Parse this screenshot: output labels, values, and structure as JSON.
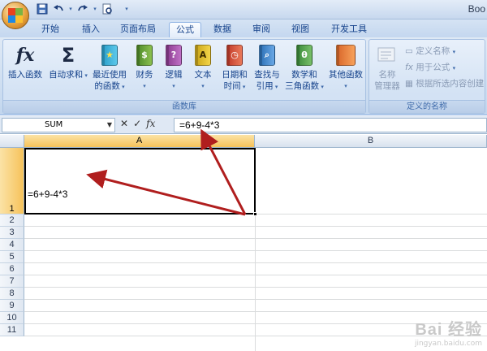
{
  "app": {
    "title": "Boo"
  },
  "quick_access": {
    "icons": [
      "save-icon",
      "undo-icon",
      "redo-icon",
      "print-preview-icon",
      "customize-dropdown-icon"
    ]
  },
  "tabs": [
    {
      "label": "开始"
    },
    {
      "label": "插入"
    },
    {
      "label": "页面布局"
    },
    {
      "label": "公式",
      "active": true
    },
    {
      "label": "数据"
    },
    {
      "label": "审阅"
    },
    {
      "label": "视图"
    },
    {
      "label": "开发工具"
    }
  ],
  "ribbon": {
    "function_library": {
      "label": "函数库",
      "insert_function": "插入函数",
      "autosum": "自动求和",
      "recent": {
        "line1": "最近使用",
        "line2": "的函数"
      },
      "financial": "财务",
      "logical": "逻辑",
      "text": "文本",
      "datetime": {
        "line1": "日期和",
        "line2": "时间"
      },
      "lookup": {
        "line1": "查找与",
        "line2": "引用"
      },
      "math": {
        "line1": "数学和",
        "line2": "三角函数"
      },
      "more": "其他函数"
    },
    "defined_names": {
      "label": "定义的名称",
      "name_manager": {
        "line1": "名称",
        "line2": "管理器"
      },
      "define_name": "定义名称",
      "use_in_formula": "用于公式",
      "create_from_selection": "根据所选内容创建"
    },
    "colors": {
      "accent": "#15428b",
      "ribbon_bg": "#d3e2f4"
    }
  },
  "formula_bar": {
    "name_box": "SUM",
    "formula": "=6+9-4*3"
  },
  "grid": {
    "columns": [
      "A",
      "B"
    ],
    "rows": [
      "1",
      "2",
      "3",
      "4",
      "5",
      "6",
      "7",
      "8",
      "9",
      "10",
      "11"
    ],
    "active_cell": "A1",
    "cells": {
      "A1": "=6+9-4*3"
    }
  },
  "watermark": {
    "main": "Bai 经验",
    "sub": "jingyan.baidu.com"
  }
}
